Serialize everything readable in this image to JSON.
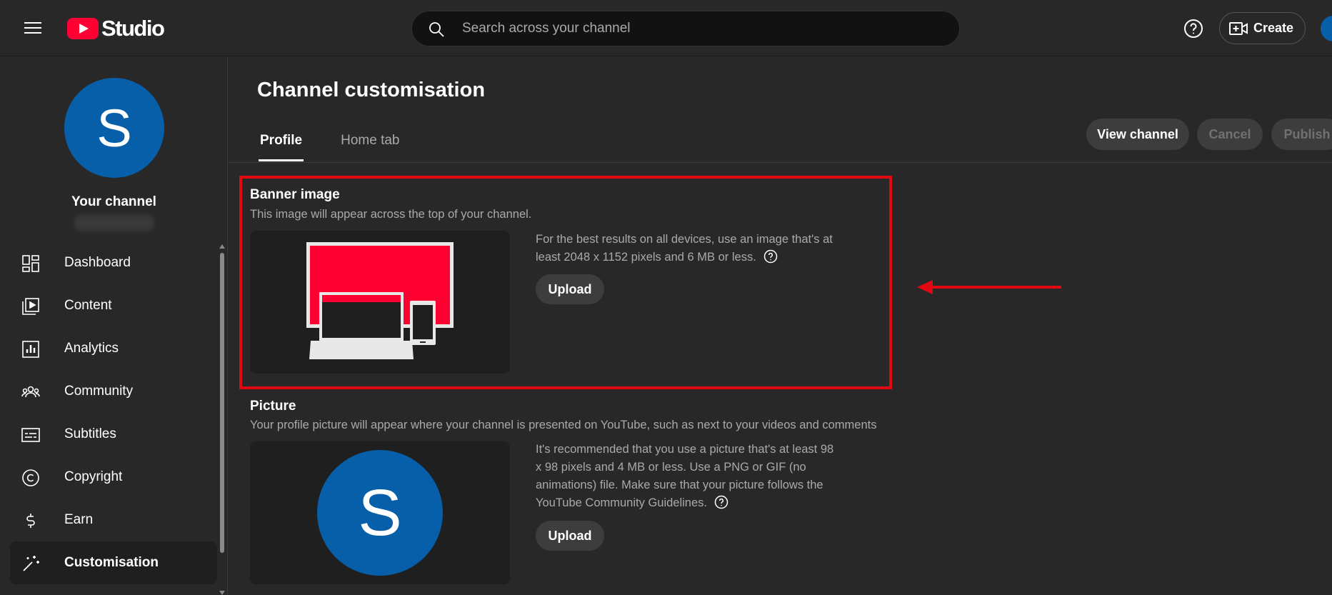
{
  "app": {
    "logo_text": "Studio"
  },
  "search": {
    "placeholder": "Search across your channel"
  },
  "header": {
    "create_label": "Create"
  },
  "sidebar": {
    "avatar_letter": "S",
    "channel_label": "Your channel",
    "items": [
      {
        "label": "Dashboard",
        "icon": "dashboard-icon"
      },
      {
        "label": "Content",
        "icon": "content-icon"
      },
      {
        "label": "Analytics",
        "icon": "analytics-icon"
      },
      {
        "label": "Community",
        "icon": "community-icon"
      },
      {
        "label": "Subtitles",
        "icon": "subtitles-icon"
      },
      {
        "label": "Copyright",
        "icon": "copyright-icon"
      },
      {
        "label": "Earn",
        "icon": "earn-icon"
      },
      {
        "label": "Customisation",
        "icon": "customisation-icon",
        "active": true
      }
    ]
  },
  "main": {
    "title": "Channel customisation",
    "tabs": [
      {
        "label": "Profile",
        "active": true
      },
      {
        "label": "Home tab",
        "active": false
      }
    ],
    "actions": {
      "view_channel": "View channel",
      "cancel": "Cancel",
      "publish": "Publish"
    },
    "banner": {
      "title": "Banner image",
      "description": "This image will appear across the top of your channel.",
      "info": "For the best results on all devices, use an image that's at least 2048 x 1152 pixels and 6 MB or less.",
      "upload_label": "Upload"
    },
    "picture": {
      "title": "Picture",
      "description": "Your profile picture will appear where your channel is presented on YouTube, such as next to your videos and comments",
      "info": "It's recommended that you use a picture that's at least 98 x 98 pixels and 4 MB or less. Use a PNG or GIF (no animations) file. Make sure that your picture follows the YouTube Community Guidelines.",
      "upload_label": "Upload",
      "avatar_letter": "S"
    }
  },
  "colors": {
    "brand_red": "#ff0033",
    "avatar_blue": "#065fa8",
    "highlight_red": "#e30613"
  }
}
